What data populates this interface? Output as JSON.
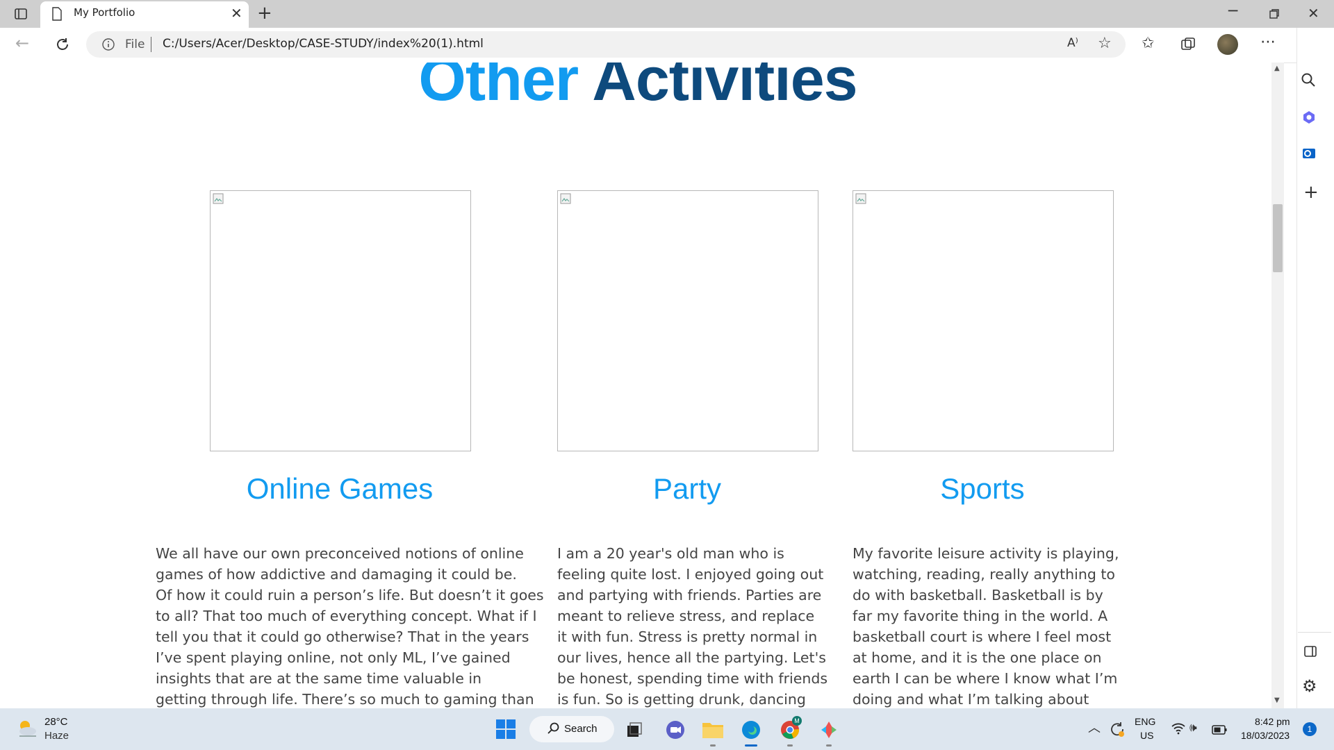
{
  "browser": {
    "tab_title": "My Portfolio",
    "file_label": "File",
    "url": "C:/Users/Acer/Desktop/CASE-STUDY/index%20(1).html",
    "read_aloud_label": "A⁾"
  },
  "page": {
    "heading_part1": "Other",
    "heading_part2": "Activities",
    "cards": [
      {
        "title": "Online Games",
        "lines": [
          "We all have our own preconceived notions of online",
          "games of how addictive and damaging it could be.",
          "Of how it could ruin a person’s life. But doesn’t it goes",
          "to all? That too much of everything concept. What if I",
          "tell you that it could go otherwise? That in the years",
          "I’ve spent playing online, not only ML, I’ve gained",
          "insights that are at the same time valuable in",
          "getting through life. There’s so much to gaming than"
        ]
      },
      {
        "title": "Party",
        "lines": [
          "I am a 20 year's old man who is",
          "feeling quite lost. I enjoyed going out",
          "and partying with friends. Parties are",
          "meant to relieve stress, and replace",
          "it with fun. Stress is pretty normal in",
          "our lives, hence all the partying. Let's",
          "be honest, spending time with friends",
          "is fun. So is getting drunk, dancing"
        ]
      },
      {
        "title": "Sports",
        "lines": [
          "My favorite leisure activity is playing,",
          "watching, reading, really anything to",
          "do with basketball. Basketball is by",
          "far my favorite thing in the world. A",
          "basketball court is where I feel most",
          "at home, and it is the one place on",
          "earth I can be where I know what I’m",
          "doing and what I’m talking about"
        ]
      }
    ]
  },
  "taskbar": {
    "weather_temp": "28°C",
    "weather_desc": "Haze",
    "search_label": "Search",
    "lang_top": "ENG",
    "lang_bottom": "US",
    "time": "8:42 pm",
    "date": "18/03/2023",
    "notification_count": "1",
    "chrome_badge": "M"
  }
}
